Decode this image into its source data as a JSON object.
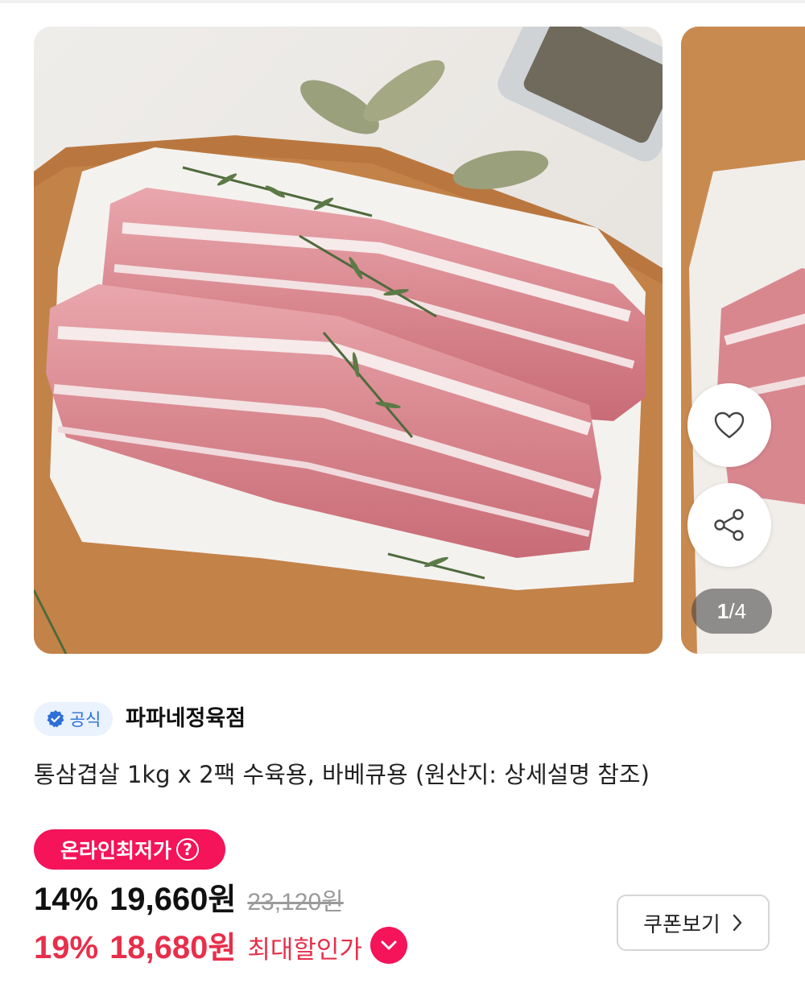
{
  "carousel": {
    "counter_current": "1",
    "counter_sep_total": "/4",
    "image_label": "pork-belly-product-photo"
  },
  "actions": {
    "wish_icon": "heart-icon",
    "share_icon": "share-icon"
  },
  "seller": {
    "badge": "공식",
    "name": "파파네정육점"
  },
  "product": {
    "title": "통삼겹살 1kg x 2팩 수육용, 바베큐용 (원산지: 상세설명 참조)"
  },
  "price": {
    "lowest_badge": "온라인최저가",
    "lowest_help": "?",
    "discount_pct": "14%",
    "sale_price": "19,660",
    "won": "원",
    "original_price": "23,120원",
    "max_discount_pct": "19%",
    "max_discount_price": "18,680",
    "max_discount_label": "최대할인가"
  },
  "coupon": {
    "label": "쿠폰보기"
  },
  "colors": {
    "accent": "#f5135a",
    "discount_red": "#e72f4b",
    "official_blue": "#2e6fd7"
  }
}
